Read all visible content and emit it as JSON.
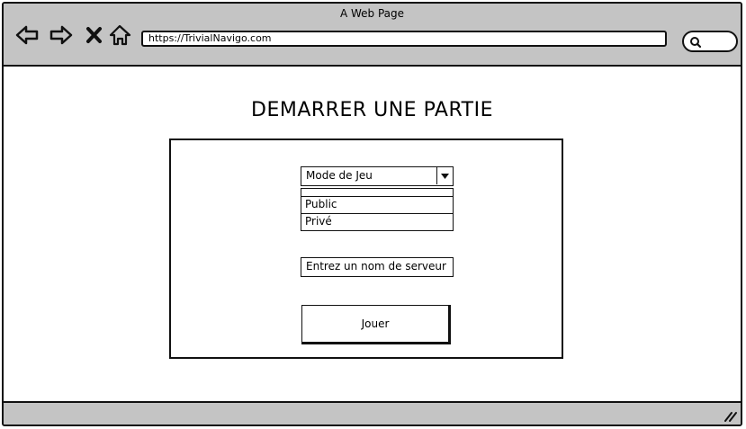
{
  "browser": {
    "window_title": "A Web Page",
    "url": "https://TrivialNavigo.com",
    "icons": {
      "back": "back-arrow-icon",
      "forward": "forward-arrow-icon",
      "stop": "close-icon",
      "home": "home-icon",
      "search": "search-icon",
      "resize": "resize-grip-icon"
    }
  },
  "main": {
    "title": "DEMARRER UNE PARTIE",
    "game_mode": {
      "selected": "Mode de Jeu",
      "options": [
        "Public",
        "Privé"
      ]
    },
    "server_name": {
      "value": "Entrez un nom de serveur"
    },
    "play_button": {
      "label": "Jouer"
    }
  }
}
